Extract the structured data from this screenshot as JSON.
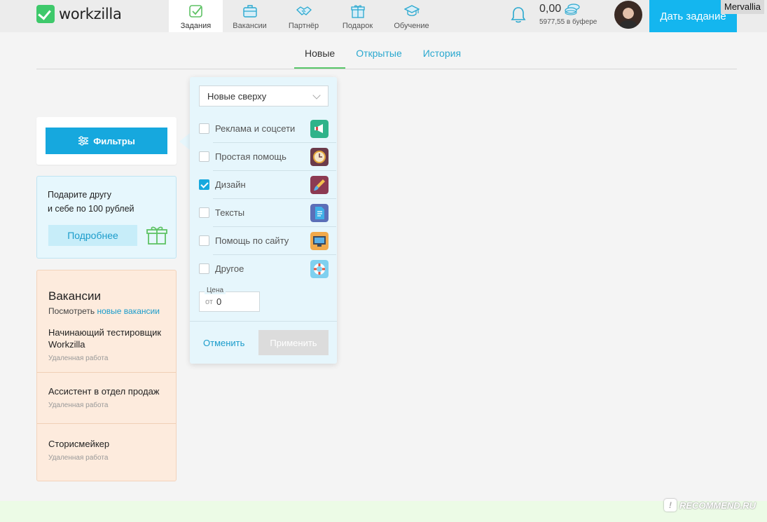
{
  "header": {
    "logo_text": "workzilla",
    "nav": [
      {
        "label": "Задания",
        "icon": "tasks-icon",
        "active": true
      },
      {
        "label": "Вакансии",
        "icon": "briefcase-icon",
        "active": false
      },
      {
        "label": "Партнёр",
        "icon": "handshake-icon",
        "active": false
      },
      {
        "label": "Подарок",
        "icon": "gift-icon",
        "active": false
      },
      {
        "label": "Обучение",
        "icon": "graduation-cap-icon",
        "active": false
      }
    ],
    "balance": "0,00",
    "buffer": "5977,55 в буфере",
    "cta_label": "Дать задание",
    "username": "Mervallia"
  },
  "tabs": [
    {
      "label": "Новые",
      "active": true
    },
    {
      "label": "Открытые",
      "active": false
    },
    {
      "label": "История",
      "active": false
    }
  ],
  "filters": {
    "button_label": "Фильтры",
    "sort_value": "Новые сверху",
    "categories": [
      {
        "label": "Реклама и соцсети",
        "checked": false,
        "icon": "megaphone-icon",
        "color": "#2fb38a"
      },
      {
        "label": "Простая помощь",
        "checked": false,
        "icon": "clock-icon",
        "color": "#6b3b4a"
      },
      {
        "label": "Дизайн",
        "checked": true,
        "icon": "brush-icon",
        "color": "#8c3a52"
      },
      {
        "label": "Тексты",
        "checked": false,
        "icon": "document-icon",
        "color": "#5b6fb8"
      },
      {
        "label": "Помощь по сайту",
        "checked": false,
        "icon": "monitor-icon",
        "color": "#f0a94a"
      },
      {
        "label": "Другое",
        "checked": false,
        "icon": "lifebuoy-icon",
        "color": "#7fd0ef"
      }
    ],
    "price_label": "Цена",
    "price_from": "от",
    "price_value": "0",
    "cancel_label": "Отменить",
    "apply_label": "Применить"
  },
  "gift": {
    "text_line1": "Подарите другу",
    "text_line2": "и себе по 100 рублей",
    "button_label": "Подробнее"
  },
  "vacancies": {
    "title": "Вакансии",
    "view_prefix": "Посмотреть",
    "view_link": "новые вакансии",
    "items": [
      {
        "name": "Начинающий тестировщик Workzilla",
        "type": "Удаленная работа"
      },
      {
        "name": "Ассистент в отдел продаж",
        "type": "Удаленная работа"
      },
      {
        "name": "Сторисмейкер",
        "type": "Удаленная работа"
      }
    ]
  },
  "watermark": "RECOMMEND.RU"
}
